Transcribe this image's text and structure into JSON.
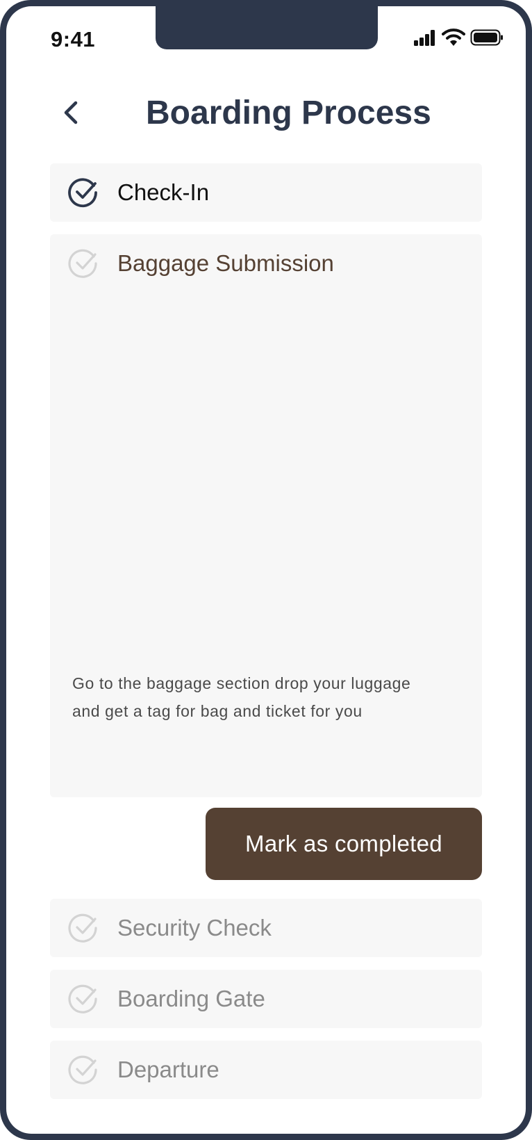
{
  "status_bar": {
    "time": "9:41",
    "icons": [
      "cellular-signal-icon",
      "wifi-icon",
      "battery-icon"
    ]
  },
  "header": {
    "back_icon": "chevron-left-icon",
    "title": "Boarding Process"
  },
  "steps": [
    {
      "label": "Check-In",
      "completed": true
    },
    {
      "label": "Baggage Submission",
      "completed": false,
      "expanded": true,
      "description": "Go to the baggage section drop your luggage and get a tag for bag and ticket for you"
    },
    {
      "label": "Security Check",
      "completed": false
    },
    {
      "label": "Boarding Gate",
      "completed": false
    },
    {
      "label": "Departure",
      "completed": false
    }
  ],
  "action": {
    "complete_label": "Mark as completed"
  },
  "colors": {
    "frame": "#2d374b",
    "card_background": "#f7f7f7",
    "completed_icon": "#2d374b",
    "inactive_icon": "#d3d3d3",
    "active_label": "#554133",
    "inactive_label": "#8a8a8a",
    "button_background": "#554133",
    "button_text": "#ffffff"
  }
}
